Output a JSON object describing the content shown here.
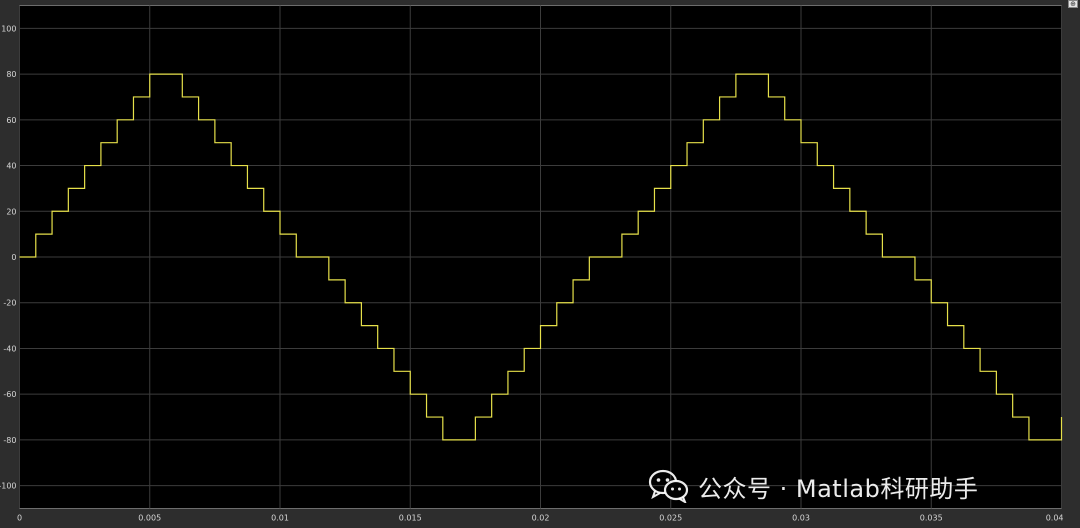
{
  "watermark": {
    "text": "公众号 · Matlab科研助手",
    "logo": "wechat-icon"
  },
  "toolbar": {
    "corner_icon": "restore-icon",
    "corner_glyph": "⊕"
  },
  "colors": {
    "background": "#000000",
    "frame": "#2d2d2d",
    "grid": "#3c3c3c",
    "signal": "#e6e04a",
    "tick_text": "#d6d6d6"
  },
  "chart_data": {
    "type": "line",
    "step": true,
    "title": "",
    "xlabel": "",
    "ylabel": "",
    "xlim": [
      0,
      0.04
    ],
    "ylim": [
      -110,
      110
    ],
    "grid": true,
    "legend": "none",
    "x_ticks": [
      0,
      0.005,
      0.01,
      0.015,
      0.02,
      0.025,
      0.03,
      0.035,
      0.04
    ],
    "x_tick_labels": [
      "0",
      "0.005",
      "0.01",
      "0.015",
      "0.02",
      "0.025",
      "0.03",
      "0.035",
      "0.04"
    ],
    "y_ticks": [
      100,
      80,
      60,
      40,
      20,
      0,
      -20,
      -40,
      -60,
      -80,
      -100
    ],
    "y_tick_labels": [
      "100",
      "80",
      "60",
      "40",
      "20",
      "0",
      "-20",
      "-40",
      "-60",
      "-80",
      "-100"
    ],
    "series": [
      {
        "color": "#e6e04a",
        "x": [
          0,
          0.000625,
          0.00125,
          0.001875,
          0.0025,
          0.003125,
          0.00375,
          0.004375,
          0.005,
          0.005625,
          0.00625,
          0.006875,
          0.0075,
          0.008125,
          0.00875,
          0.009375,
          0.01,
          0.010625,
          0.01125,
          0.011875,
          0.0125,
          0.013125,
          0.01375,
          0.014375,
          0.015,
          0.015625,
          0.01625,
          0.016875,
          0.0175,
          0.018125,
          0.01875,
          0.019375,
          0.02,
          0.020625,
          0.02125,
          0.021875,
          0.0225,
          0.023125,
          0.02375,
          0.024375,
          0.025,
          0.025625,
          0.02625,
          0.026875,
          0.0275,
          0.028125,
          0.02875,
          0.029375,
          0.03,
          0.030625,
          0.03125,
          0.031875,
          0.0325,
          0.033125,
          0.03375,
          0.034375,
          0.035,
          0.035625,
          0.03625,
          0.036875,
          0.0375,
          0.038125,
          0.03875,
          0.039375,
          0.04
        ],
        "y": [
          0,
          10,
          20,
          30,
          40,
          50,
          60,
          70,
          80,
          80,
          70,
          60,
          50,
          40,
          30,
          20,
          10,
          0,
          0,
          -10,
          -20,
          -30,
          -40,
          -50,
          -60,
          -70,
          -80,
          -80,
          -70,
          -60,
          -50,
          -40,
          -30,
          -20,
          -10,
          0,
          0,
          10,
          20,
          30,
          40,
          50,
          60,
          70,
          80,
          80,
          70,
          60,
          50,
          40,
          30,
          20,
          10,
          0,
          0,
          -10,
          -20,
          -30,
          -40,
          -50,
          -60,
          -70,
          -80,
          -80,
          -70
        ]
      }
    ]
  }
}
